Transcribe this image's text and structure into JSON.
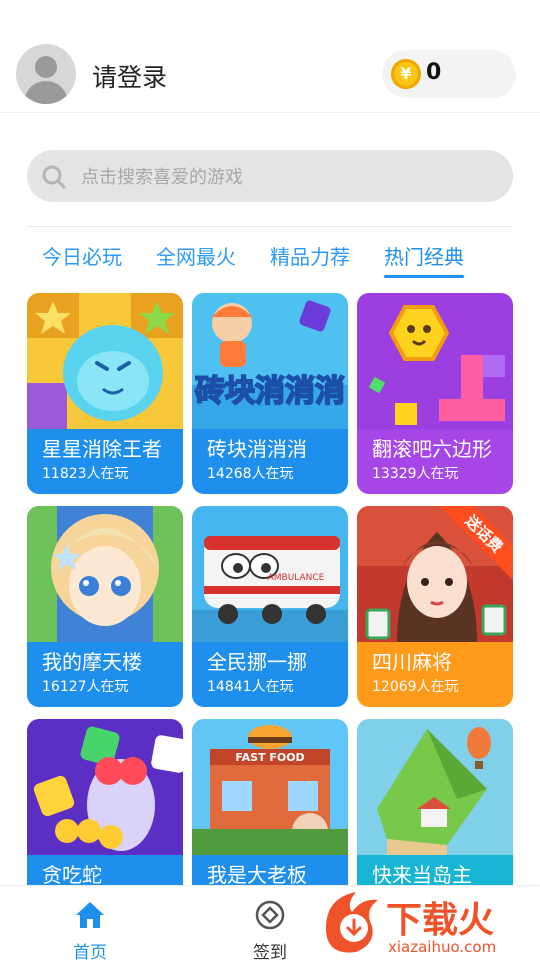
{
  "header": {
    "login_label": "请登录",
    "coin_symbol": "¥",
    "coin_count": "0"
  },
  "search": {
    "placeholder": "点击搜索喜爱的游戏"
  },
  "tabs": [
    {
      "label": "今日必玩",
      "active": false
    },
    {
      "label": "全网最火",
      "active": false
    },
    {
      "label": "精品力荐",
      "active": false
    },
    {
      "label": "热门经典",
      "active": true
    }
  ],
  "games": [
    {
      "name": "星星消除王者",
      "players": "11823人在玩",
      "art_title": "",
      "color": "#1f8fee"
    },
    {
      "name": "砖块消消消",
      "players": "14268人在玩",
      "art_title": "砖块消消消",
      "color": "#1f8fee"
    },
    {
      "name": "翻滚吧六边形",
      "players": "13329人在玩",
      "art_title": "",
      "color": "#a646e6"
    },
    {
      "name": "我的摩天楼",
      "players": "16127人在玩",
      "art_title": "",
      "color": "#1f8fee"
    },
    {
      "name": "全民挪一挪",
      "players": "14841人在玩",
      "art_title": "AMBULANCE",
      "color": "#1f8fee"
    },
    {
      "name": "四川麻将",
      "players": "12069人在玩",
      "badge": "送话费",
      "color": "#ff9a1a"
    },
    {
      "name": "贪吃蛇",
      "players": "",
      "color": "#1f8fee"
    },
    {
      "name": "我是大老板",
      "players": "",
      "art_title": "FAST FOOD",
      "color": "#1f8fee"
    },
    {
      "name": "快来当岛主",
      "players": "",
      "color": "#19b5d4"
    }
  ],
  "bottom_nav": [
    {
      "label": "首页",
      "icon": "home-icon",
      "active": true,
      "color": "#1f8fee"
    },
    {
      "label": "签到",
      "icon": "check-in-icon",
      "active": false,
      "color": "#333333"
    }
  ],
  "watermark": {
    "brand": "下载火",
    "url": "xiazaihuo.com"
  }
}
